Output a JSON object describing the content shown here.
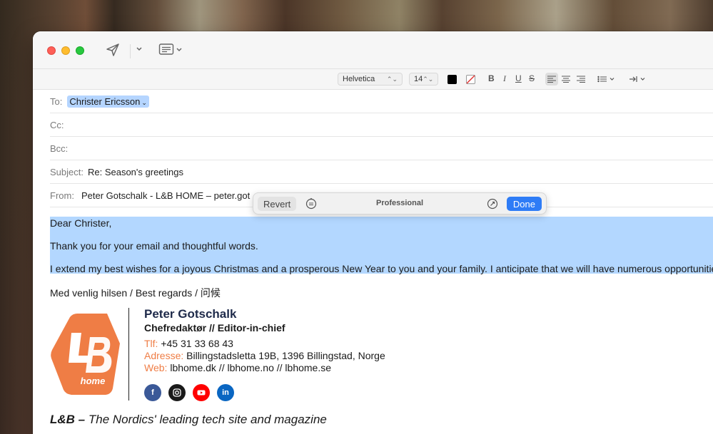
{
  "toolbar": {
    "font_name": "Helvetica",
    "font_size": "14",
    "bold": "B",
    "italic": "I",
    "underline": "U",
    "strikethrough": "S"
  },
  "headers": {
    "to_label": "To:",
    "to_recipient": "Christer Ericsson",
    "cc_label": "Cc:",
    "bcc_label": "Bcc:",
    "subject_label": "Subject:",
    "subject_value": "Re: Season's greetings",
    "from_label": "From:",
    "from_value": "Peter Gotschalk - L&B HOME – peter.got"
  },
  "rewrite_popover": {
    "revert_label": "Revert",
    "tone": "Professional",
    "done_label": "Done"
  },
  "body": {
    "greeting": "Dear Christer,",
    "line1": "Thank you for your email and thoughtful words.",
    "line2": "I extend my best wishes for a joyous Christmas and a prosperous New Year to you and your family. I anticipate that we will have numerous opportunitie",
    "closing": "Med venlig hilsen / Best regards / 问候"
  },
  "signature": {
    "logo_text": "home",
    "name": "Peter Gotschalk",
    "title": "Chefredaktør // Editor-in-chief",
    "phone_label": "Tlf:",
    "phone": "+45 31 33 68 43",
    "address_label": "Adresse:",
    "address": "Billingstadsletta 19B, 1396 Billingstad, Norge",
    "web_label": "Web:",
    "web": "lbhome.dk // lbhome.no // lbhome.se",
    "tagline_bold": "L&B –",
    "tagline": "The Nordics' leading tech site and magazine"
  },
  "colors": {
    "accent": "#2e7cf6",
    "selection": "#b3d7ff",
    "orange": "#ef7d45",
    "facebook": "#3b5998",
    "instagram": "#1a1a1a",
    "youtube": "#ff0000",
    "linkedin": "#0a66c2"
  }
}
